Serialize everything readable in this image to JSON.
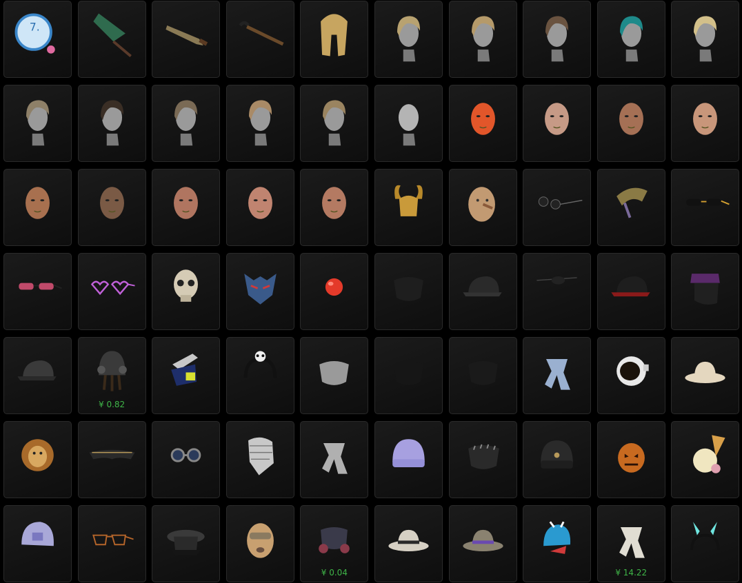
{
  "colors": {
    "background": "#000000",
    "tile_border": "#2a2a2a",
    "price": "#3fb548"
  },
  "items": [
    {
      "name": "candy-sticker-icon"
    },
    {
      "name": "fan-weapon-icon"
    },
    {
      "name": "machete-icon"
    },
    {
      "name": "sickle-icon"
    },
    {
      "name": "long-blonde-hair-icon"
    },
    {
      "name": "braided-updo-hair-icon"
    },
    {
      "name": "swept-blonde-hair-icon"
    },
    {
      "name": "undercut-hair-icon"
    },
    {
      "name": "teal-bob-hair-icon"
    },
    {
      "name": "blonde-bun-hair-icon"
    },
    {
      "name": "messy-hair-icon"
    },
    {
      "name": "cornrows-hair-icon"
    },
    {
      "name": "side-part-hair-icon"
    },
    {
      "name": "bob-hair-icon"
    },
    {
      "name": "bowl-cut-hair-icon"
    },
    {
      "name": "bald-head-icon"
    },
    {
      "name": "orange-face-icon"
    },
    {
      "name": "female-face-icon"
    },
    {
      "name": "bearded-face-icon"
    },
    {
      "name": "bald-face-icon"
    },
    {
      "name": "male-face-icon"
    },
    {
      "name": "shaved-face-icon"
    },
    {
      "name": "female-face-2-icon"
    },
    {
      "name": "female-face-3-icon"
    },
    {
      "name": "female-face-4-icon"
    },
    {
      "name": "horned-helmet-icon"
    },
    {
      "name": "wooden-mask-icon"
    },
    {
      "name": "round-sunglasses-icon"
    },
    {
      "name": "camo-hair-icon"
    },
    {
      "name": "black-glasses-icon"
    },
    {
      "name": "gradient-sunglasses-icon"
    },
    {
      "name": "heart-glasses-icon"
    },
    {
      "name": "skull-mask-icon"
    },
    {
      "name": "demon-mask-icon"
    },
    {
      "name": "clown-nose-icon"
    },
    {
      "name": "black-face-mask-icon"
    },
    {
      "name": "black-cap-icon"
    },
    {
      "name": "eyepatch-icon"
    },
    {
      "name": "red-stripe-cap-icon"
    },
    {
      "name": "visor-mask-icon"
    },
    {
      "name": "camo-cap-icon"
    },
    {
      "name": "pilot-helmet-icon",
      "price": "¥ 0.82"
    },
    {
      "name": "respirator-icon"
    },
    {
      "name": "panda-headband-icon"
    },
    {
      "name": "silver-mask-icon"
    },
    {
      "name": "bandana-mask-icon"
    },
    {
      "name": "face-wrap-icon"
    },
    {
      "name": "blue-scarf-icon"
    },
    {
      "name": "astronaut-helmet-icon"
    },
    {
      "name": "pith-helmet-icon"
    },
    {
      "name": "lion-mask-icon"
    },
    {
      "name": "sport-sunglasses-icon"
    },
    {
      "name": "steampunk-goggles-icon"
    },
    {
      "name": "shemagh-icon"
    },
    {
      "name": "grey-scarf-icon"
    },
    {
      "name": "purple-beanie-icon"
    },
    {
      "name": "spiked-mask-icon"
    },
    {
      "name": "black-beanie-icon"
    },
    {
      "name": "pumpkin-mask-icon"
    },
    {
      "name": "ice-cream-hat-icon"
    },
    {
      "name": "lavender-turban-icon"
    },
    {
      "name": "aviator-glasses-icon"
    },
    {
      "name": "officer-cap-icon"
    },
    {
      "name": "balaclava-icon"
    },
    {
      "name": "gas-mask-icon",
      "price": "¥ 0.04"
    },
    {
      "name": "fedora-icon"
    },
    {
      "name": "purple-pith-helmet-icon"
    },
    {
      "name": "dragon-hat-icon"
    },
    {
      "name": "white-scarf-icon",
      "price": "¥ 14.22"
    },
    {
      "name": "bunny-ears-icon"
    }
  ]
}
